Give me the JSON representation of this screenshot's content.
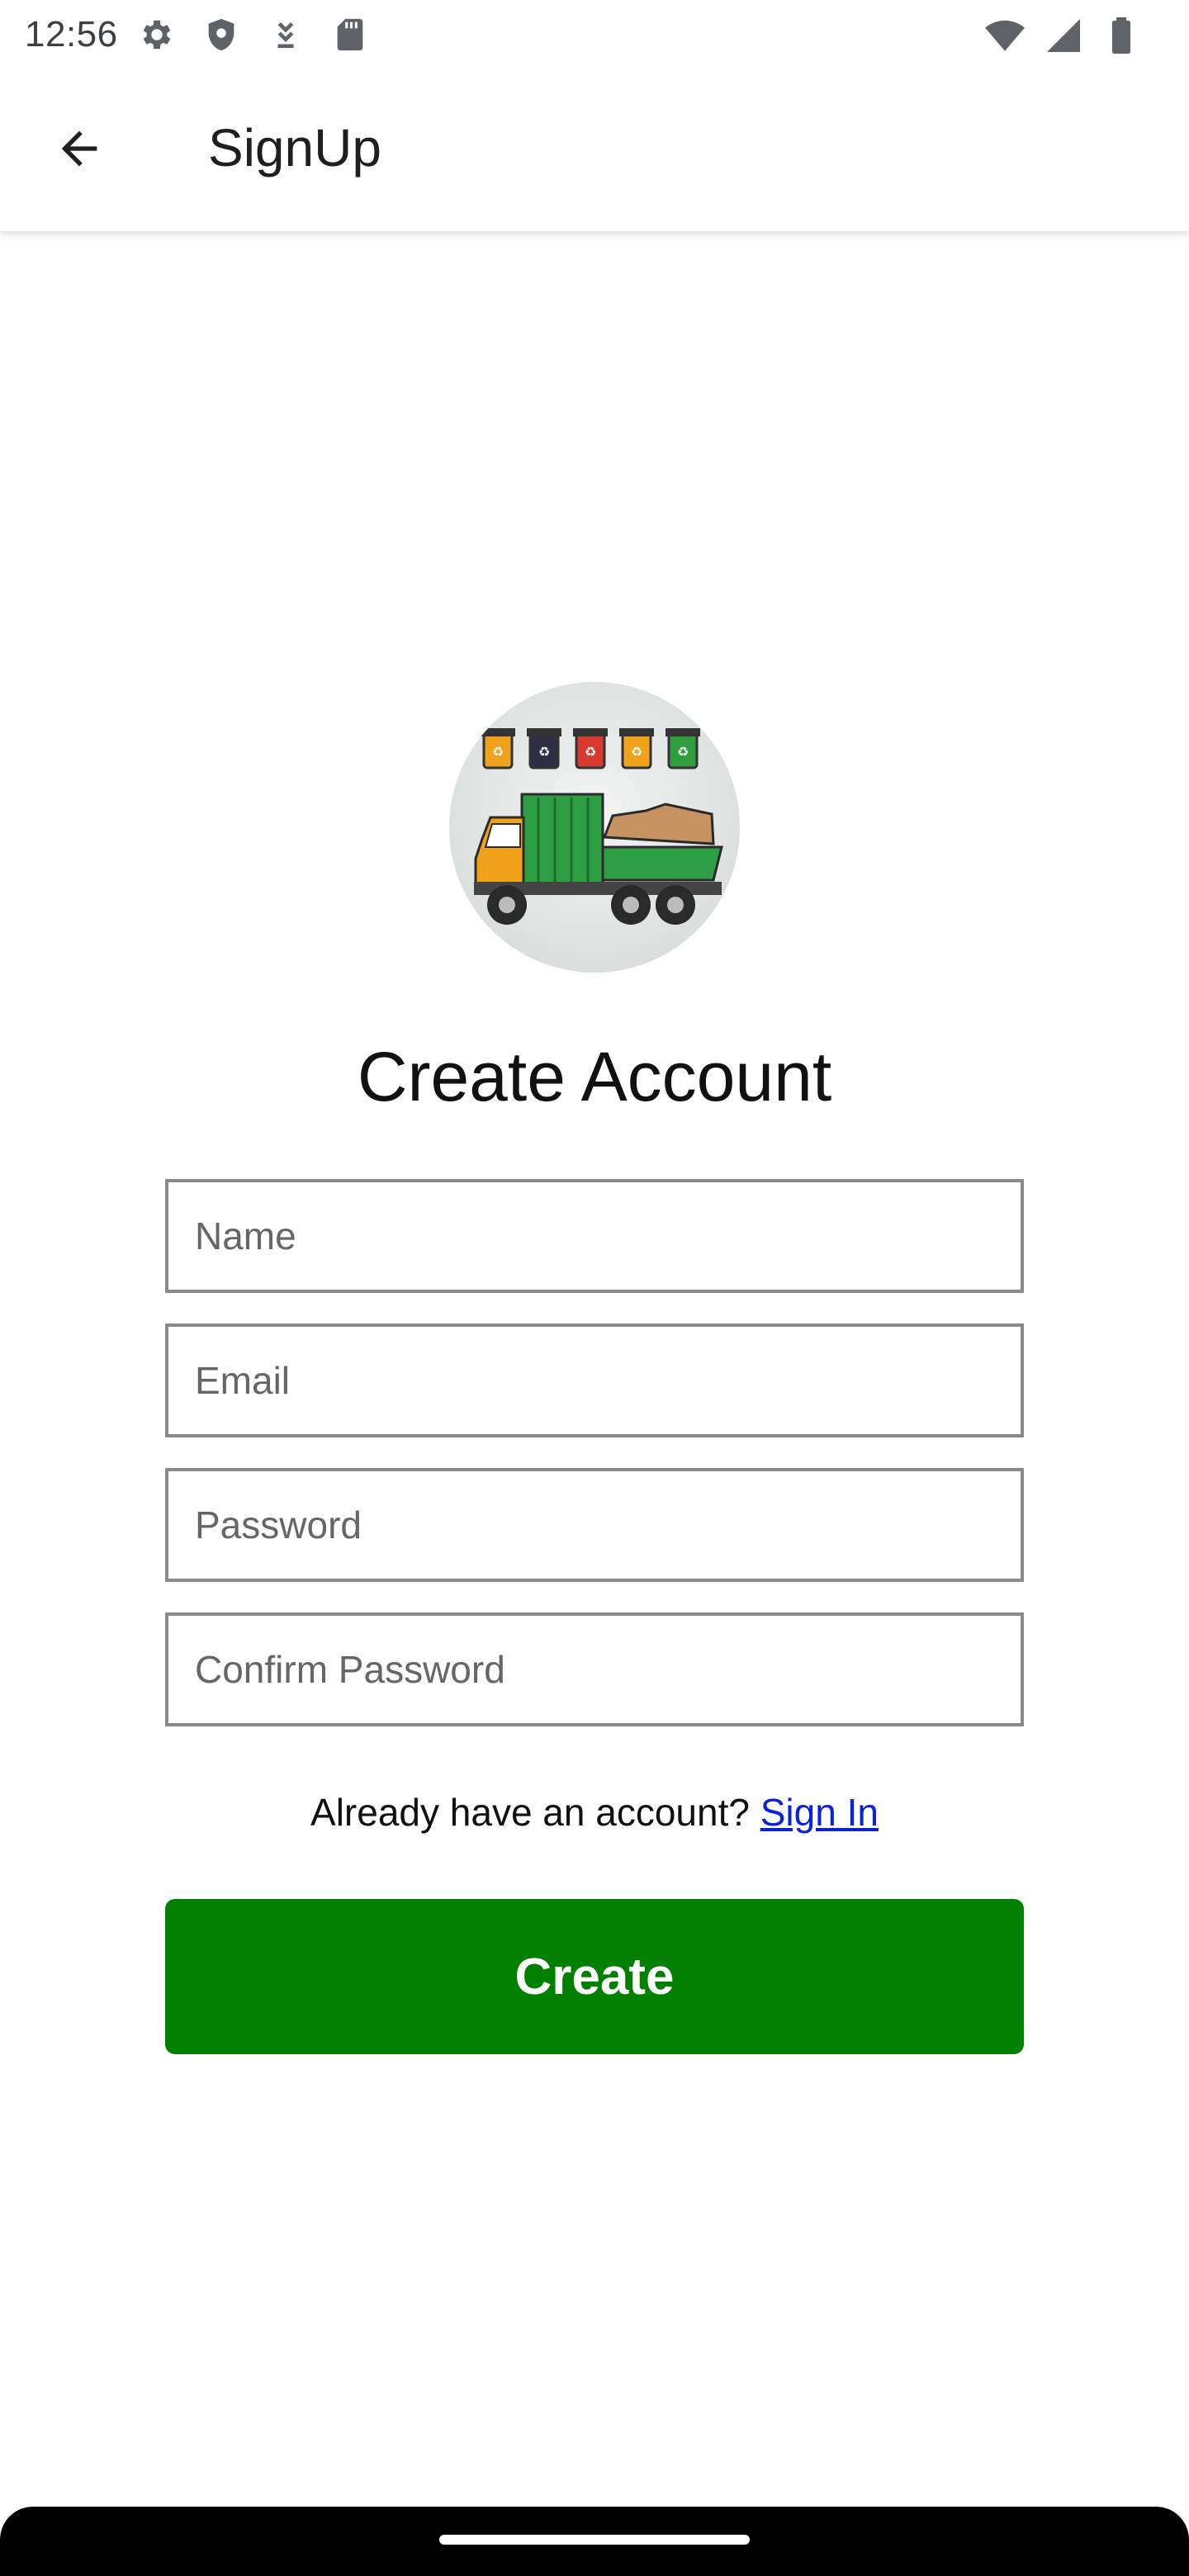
{
  "status_bar": {
    "time": "12:56",
    "left_icons": [
      "gear-icon",
      "shield-icon",
      "download-icon",
      "sd-card-icon"
    ],
    "right_icons": [
      "wifi-icon",
      "signal-icon",
      "battery-icon"
    ]
  },
  "app_bar": {
    "title": "SignUp",
    "back_icon": "arrow-left-icon"
  },
  "logo": {
    "icon": "garbage-truck-with-recycle-bins-icon"
  },
  "form": {
    "heading": "Create Account",
    "fields": [
      {
        "placeholder": "Name",
        "value": ""
      },
      {
        "placeholder": "Email",
        "value": ""
      },
      {
        "placeholder": "Password",
        "value": ""
      },
      {
        "placeholder": "Confirm Password",
        "value": ""
      }
    ],
    "signin_prompt": "Already have an account?",
    "signin_link": "Sign In",
    "create_label": "Create"
  },
  "colors": {
    "primary_green": "#007f00",
    "link_blue": "#0b22d6",
    "field_border": "#8a8a8a"
  }
}
